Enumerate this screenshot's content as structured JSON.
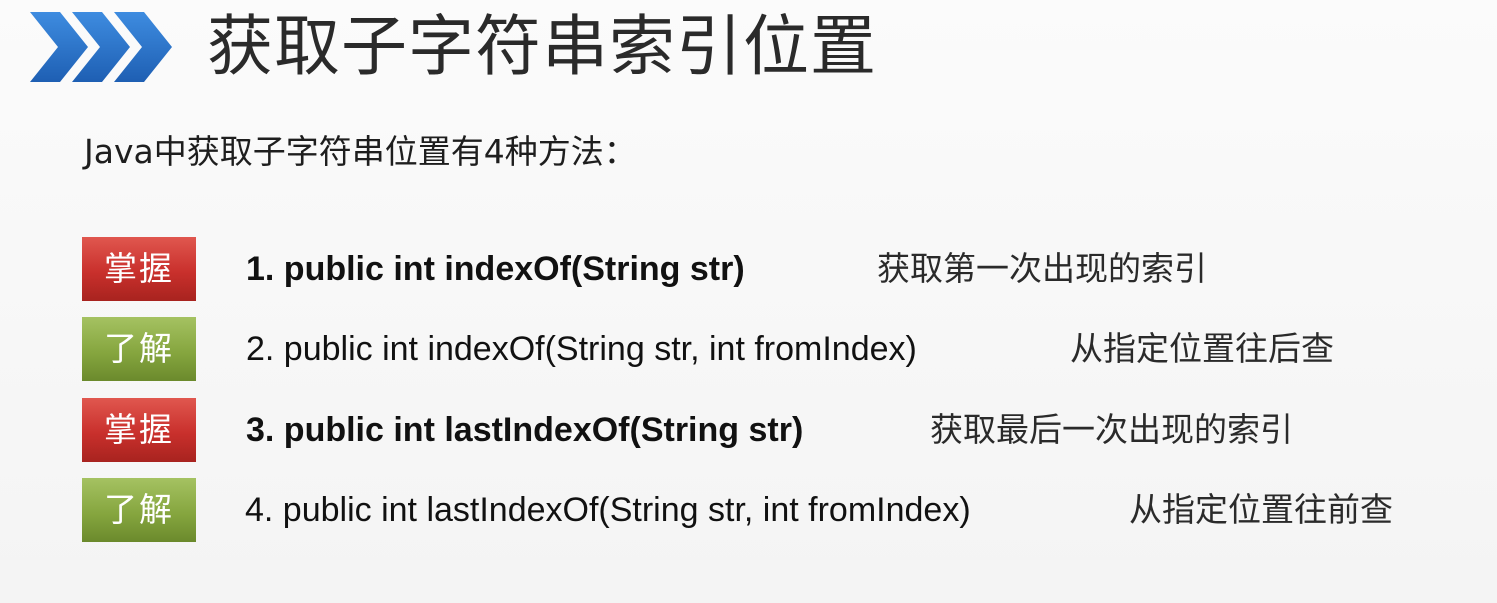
{
  "header": {
    "title": "获取子字符串索引位置",
    "icon": "triple-chevron-right-icon",
    "icon_colors": [
      "#1e63b8",
      "#3e8ce0"
    ]
  },
  "intro": "Java中获取子字符串位置有4种方法：",
  "items": [
    {
      "badge": "掌握",
      "badge_color": "#c9302c",
      "method": "1. public int indexOf(String str)",
      "bold": true,
      "description": "获取第一次出现的索引"
    },
    {
      "badge": "了解",
      "badge_color": "#86a63f",
      "method": "2. public int indexOf(String str, int fromIndex)",
      "bold": false,
      "description": "从指定位置往后查"
    },
    {
      "badge": "掌握",
      "badge_color": "#c9302c",
      "method": "3. public int lastIndexOf(String str)",
      "bold": true,
      "description": "获取最后一次出现的索引"
    },
    {
      "badge": "了解",
      "badge_color": "#86a63f",
      "method": "4. public int lastIndexOf(String str, int fromIndex)",
      "bold": false,
      "description": "从指定位置往前查"
    }
  ]
}
